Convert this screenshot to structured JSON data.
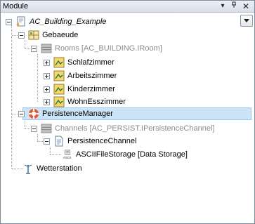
{
  "panel": {
    "title": "Module",
    "dropdown_label": "▾",
    "pin_label": "ᵖ",
    "close_label": "×"
  },
  "tree": {
    "root": "AC_Building_Example",
    "gebaeude": "Gebaeude",
    "rooms": "Rooms [AC_BUILDING.IRoom]",
    "schlafzimmer": "Schlafzimmer",
    "arbeitszimmer": "Arbeitszimmer",
    "kinderzimmer": "Kinderzimmer",
    "wohnesszimmer": "WohnEsszimmer",
    "persistence_manager": "PersistenceManager",
    "channels": "Channels [AC_PERSIST.IPersistenceChannel]",
    "persistence_channel": "PersistenceChannel",
    "ascii_storage": "ASCIIFileStorage [Data Storage]",
    "ascii_icon_text": "ASCII",
    "wetterstation": "Wetterstation"
  },
  "colors": {
    "selection": "#cce4f7",
    "muted_text": "#8a8a8a"
  }
}
